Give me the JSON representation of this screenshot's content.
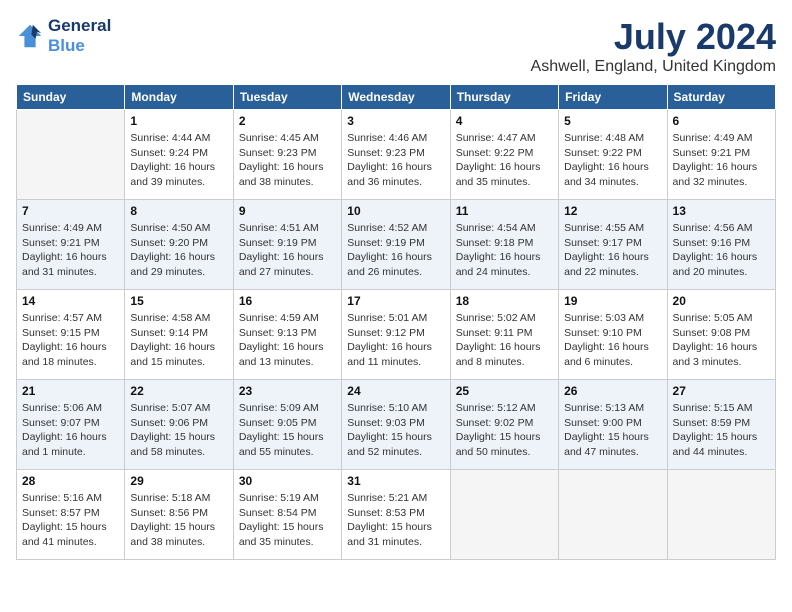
{
  "logo": {
    "line1": "General",
    "line2": "Blue"
  },
  "title": "July 2024",
  "subtitle": "Ashwell, England, United Kingdom",
  "days_of_week": [
    "Sunday",
    "Monday",
    "Tuesday",
    "Wednesday",
    "Thursday",
    "Friday",
    "Saturday"
  ],
  "weeks": [
    [
      {
        "day": "",
        "info": ""
      },
      {
        "day": "1",
        "info": "Sunrise: 4:44 AM\nSunset: 9:24 PM\nDaylight: 16 hours\nand 39 minutes."
      },
      {
        "day": "2",
        "info": "Sunrise: 4:45 AM\nSunset: 9:23 PM\nDaylight: 16 hours\nand 38 minutes."
      },
      {
        "day": "3",
        "info": "Sunrise: 4:46 AM\nSunset: 9:23 PM\nDaylight: 16 hours\nand 36 minutes."
      },
      {
        "day": "4",
        "info": "Sunrise: 4:47 AM\nSunset: 9:22 PM\nDaylight: 16 hours\nand 35 minutes."
      },
      {
        "day": "5",
        "info": "Sunrise: 4:48 AM\nSunset: 9:22 PM\nDaylight: 16 hours\nand 34 minutes."
      },
      {
        "day": "6",
        "info": "Sunrise: 4:49 AM\nSunset: 9:21 PM\nDaylight: 16 hours\nand 32 minutes."
      }
    ],
    [
      {
        "day": "7",
        "info": "Sunrise: 4:49 AM\nSunset: 9:21 PM\nDaylight: 16 hours\nand 31 minutes."
      },
      {
        "day": "8",
        "info": "Sunrise: 4:50 AM\nSunset: 9:20 PM\nDaylight: 16 hours\nand 29 minutes."
      },
      {
        "day": "9",
        "info": "Sunrise: 4:51 AM\nSunset: 9:19 PM\nDaylight: 16 hours\nand 27 minutes."
      },
      {
        "day": "10",
        "info": "Sunrise: 4:52 AM\nSunset: 9:19 PM\nDaylight: 16 hours\nand 26 minutes."
      },
      {
        "day": "11",
        "info": "Sunrise: 4:54 AM\nSunset: 9:18 PM\nDaylight: 16 hours\nand 24 minutes."
      },
      {
        "day": "12",
        "info": "Sunrise: 4:55 AM\nSunset: 9:17 PM\nDaylight: 16 hours\nand 22 minutes."
      },
      {
        "day": "13",
        "info": "Sunrise: 4:56 AM\nSunset: 9:16 PM\nDaylight: 16 hours\nand 20 minutes."
      }
    ],
    [
      {
        "day": "14",
        "info": "Sunrise: 4:57 AM\nSunset: 9:15 PM\nDaylight: 16 hours\nand 18 minutes."
      },
      {
        "day": "15",
        "info": "Sunrise: 4:58 AM\nSunset: 9:14 PM\nDaylight: 16 hours\nand 15 minutes."
      },
      {
        "day": "16",
        "info": "Sunrise: 4:59 AM\nSunset: 9:13 PM\nDaylight: 16 hours\nand 13 minutes."
      },
      {
        "day": "17",
        "info": "Sunrise: 5:01 AM\nSunset: 9:12 PM\nDaylight: 16 hours\nand 11 minutes."
      },
      {
        "day": "18",
        "info": "Sunrise: 5:02 AM\nSunset: 9:11 PM\nDaylight: 16 hours\nand 8 minutes."
      },
      {
        "day": "19",
        "info": "Sunrise: 5:03 AM\nSunset: 9:10 PM\nDaylight: 16 hours\nand 6 minutes."
      },
      {
        "day": "20",
        "info": "Sunrise: 5:05 AM\nSunset: 9:08 PM\nDaylight: 16 hours\nand 3 minutes."
      }
    ],
    [
      {
        "day": "21",
        "info": "Sunrise: 5:06 AM\nSunset: 9:07 PM\nDaylight: 16 hours\nand 1 minute."
      },
      {
        "day": "22",
        "info": "Sunrise: 5:07 AM\nSunset: 9:06 PM\nDaylight: 15 hours\nand 58 minutes."
      },
      {
        "day": "23",
        "info": "Sunrise: 5:09 AM\nSunset: 9:05 PM\nDaylight: 15 hours\nand 55 minutes."
      },
      {
        "day": "24",
        "info": "Sunrise: 5:10 AM\nSunset: 9:03 PM\nDaylight: 15 hours\nand 52 minutes."
      },
      {
        "day": "25",
        "info": "Sunrise: 5:12 AM\nSunset: 9:02 PM\nDaylight: 15 hours\nand 50 minutes."
      },
      {
        "day": "26",
        "info": "Sunrise: 5:13 AM\nSunset: 9:00 PM\nDaylight: 15 hours\nand 47 minutes."
      },
      {
        "day": "27",
        "info": "Sunrise: 5:15 AM\nSunset: 8:59 PM\nDaylight: 15 hours\nand 44 minutes."
      }
    ],
    [
      {
        "day": "28",
        "info": "Sunrise: 5:16 AM\nSunset: 8:57 PM\nDaylight: 15 hours\nand 41 minutes."
      },
      {
        "day": "29",
        "info": "Sunrise: 5:18 AM\nSunset: 8:56 PM\nDaylight: 15 hours\nand 38 minutes."
      },
      {
        "day": "30",
        "info": "Sunrise: 5:19 AM\nSunset: 8:54 PM\nDaylight: 15 hours\nand 35 minutes."
      },
      {
        "day": "31",
        "info": "Sunrise: 5:21 AM\nSunset: 8:53 PM\nDaylight: 15 hours\nand 31 minutes."
      },
      {
        "day": "",
        "info": ""
      },
      {
        "day": "",
        "info": ""
      },
      {
        "day": "",
        "info": ""
      }
    ]
  ]
}
